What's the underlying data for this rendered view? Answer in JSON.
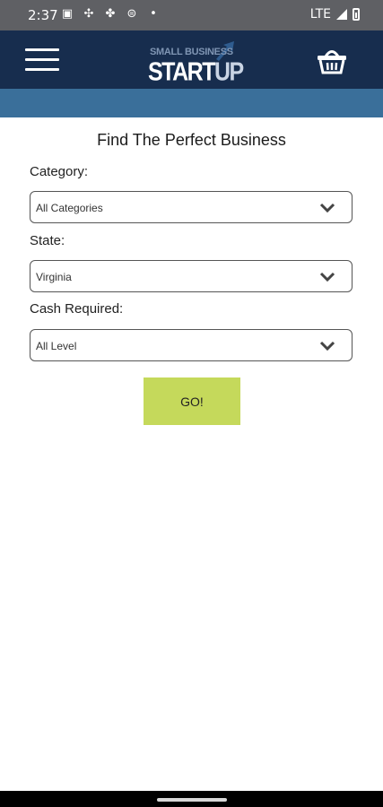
{
  "status_bar": {
    "time": "2:37",
    "network": "LTE",
    "icons": [
      "notification-icon",
      "slack-icon",
      "fan-icon",
      "sim-icon",
      "dot-icon"
    ]
  },
  "header": {
    "menu_icon": "hamburger-menu-icon",
    "logo_top": "SMALL BUSINESS",
    "logo_start": "START",
    "logo_up": "UP",
    "cart_icon": "basket-icon"
  },
  "finder": {
    "title": "Find The Perfect Business",
    "category_label": "Category:",
    "category_value": "All Categories",
    "state_label": "State:",
    "state_value": "Virginia",
    "cash_label": "Cash Required:",
    "cash_value": "All Level",
    "go_label": "GO!"
  },
  "colors": {
    "header": "#172d4e",
    "band": "#3a6f9a",
    "go_button": "#c5d95b"
  }
}
